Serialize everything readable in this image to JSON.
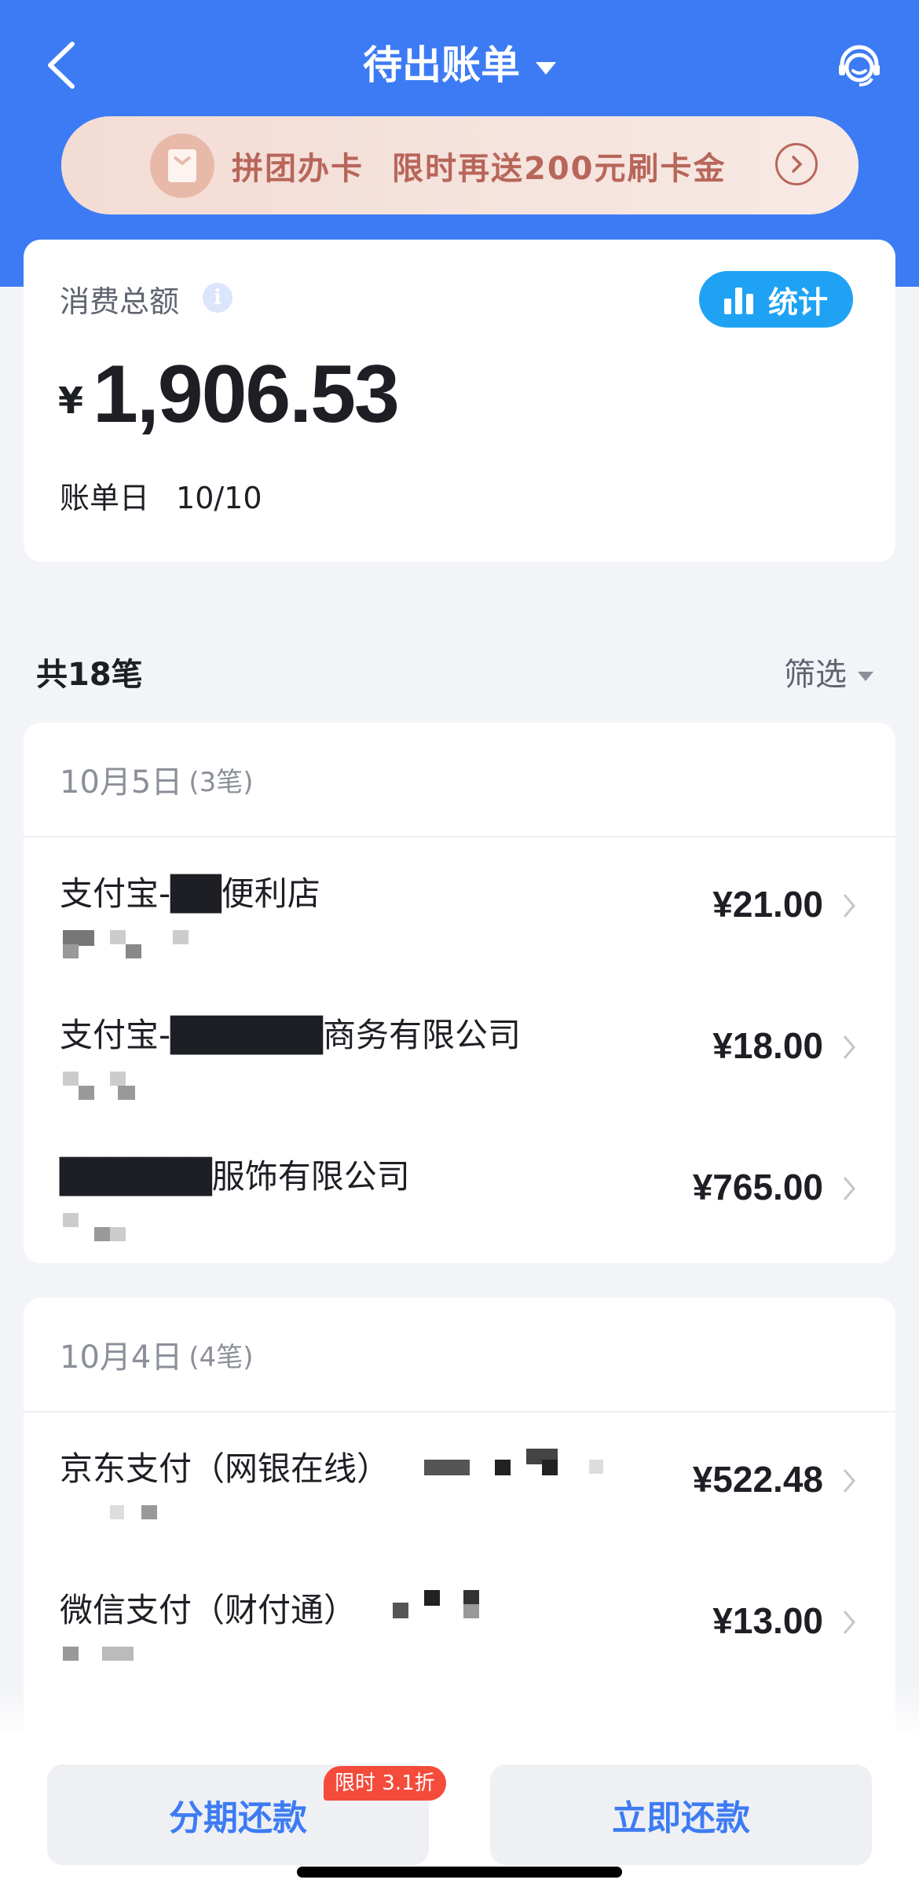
{
  "header": {
    "title": "待出账单",
    "back_icon": "chevron-left-icon",
    "service_icon": "customer-service-icon"
  },
  "promo": {
    "part1": "拼团办卡",
    "part2": "限时再送200元刷卡金",
    "icon": "gift-card-icon"
  },
  "summary": {
    "label": "消费总额",
    "stats_label": "统计",
    "currency": "¥",
    "amount": "1,906.53",
    "bill_day_label": "账单日",
    "bill_day": "10/10"
  },
  "list": {
    "count_label": "共18笔",
    "filter_label": "筛选"
  },
  "groups": [
    {
      "date": "10月5日",
      "count": "(3笔)",
      "transactions": [
        {
          "name": "支付宝-██便利店",
          "amount": "¥21.00"
        },
        {
          "name": "支付宝-██████商务有限公司",
          "amount": "¥18.00"
        },
        {
          "name": "██████服饰有限公司",
          "amount": "¥765.00"
        }
      ]
    },
    {
      "date": "10月4日",
      "count": "(4笔)",
      "transactions": [
        {
          "name": "京东支付（网银在线）",
          "amount": "¥522.48"
        },
        {
          "name": "微信支付（财付通）",
          "amount": "¥13.00"
        }
      ]
    }
  ],
  "footer": {
    "installment_label": "分期还款",
    "installment_badge": "限时 3.1折",
    "repay_label": "立即还款"
  },
  "colors": {
    "brand": "#3d7bf4",
    "stats": "#1fa2f4",
    "promo_text": "#b8665a",
    "badge": "#f44b3b"
  }
}
